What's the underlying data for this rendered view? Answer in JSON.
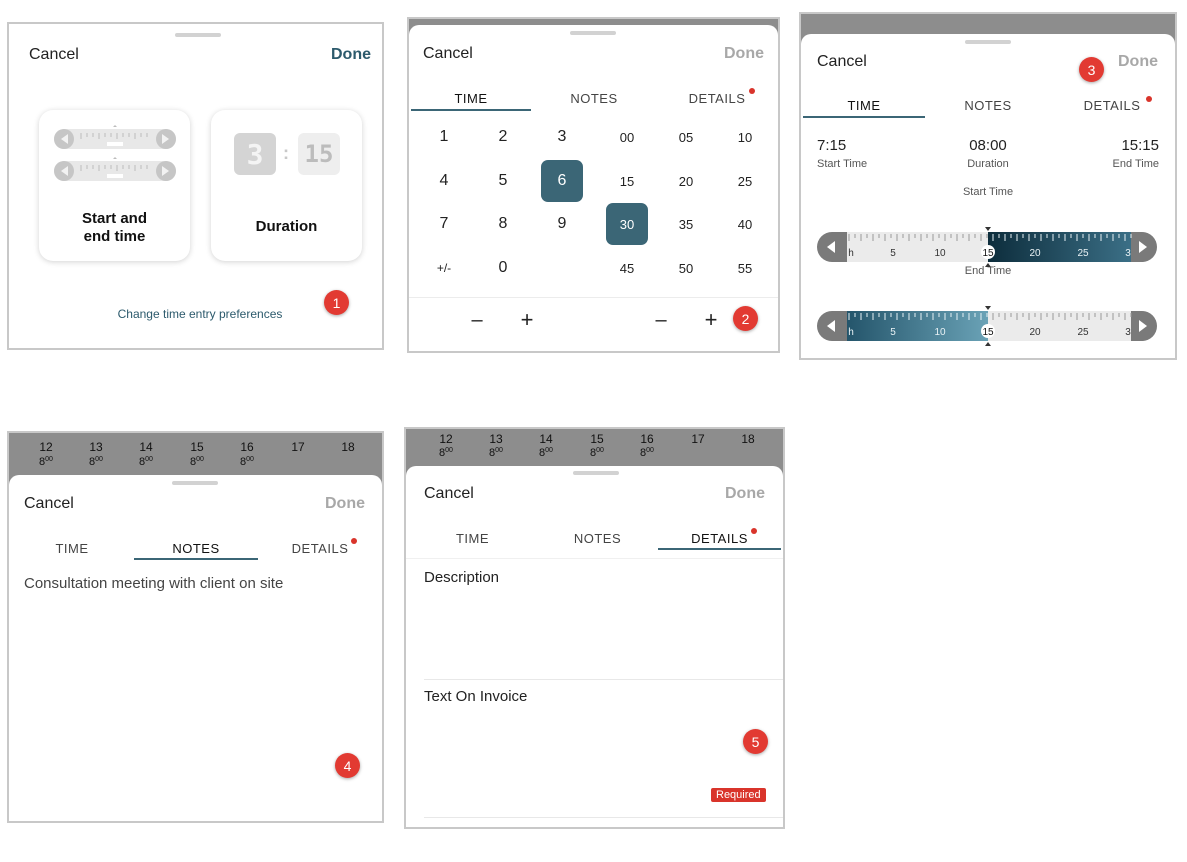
{
  "badges": [
    "1",
    "2",
    "3",
    "4",
    "5"
  ],
  "common": {
    "cancel": "Cancel",
    "done": "Done",
    "tabs": [
      "TIME",
      "NOTES",
      "DETAILS"
    ]
  },
  "panel1": {
    "option1": "Start and end time",
    "option1_line1": "Start and",
    "option1_line2": "end time",
    "option2": "Duration",
    "duration_hours": "3",
    "duration_colon": ":",
    "duration_minutes": "15",
    "link": "Change time entry preferences"
  },
  "panel2": {
    "hour_keys": [
      "1",
      "2",
      "3",
      "4",
      "5",
      "6",
      "7",
      "8",
      "9",
      "+/-",
      "0"
    ],
    "minute_keys": [
      "00",
      "05",
      "10",
      "15",
      "20",
      "25",
      "30",
      "35",
      "40",
      "45",
      "50",
      "55"
    ],
    "selected_hour": "6",
    "selected_minute": "30",
    "minus": "–",
    "plus": "+"
  },
  "panel3": {
    "start_value": "7:15",
    "start_label": "Start Time",
    "duration_value": "08:00",
    "duration_label": "Duration",
    "end_value": "15:15",
    "end_label": "End Time",
    "ruler1_title": "Start Time",
    "ruler2_title": "End Time",
    "ruler1_ticks": [
      "h",
      "5",
      "10",
      "15",
      "20",
      "25",
      "3"
    ],
    "ruler2_ticks": [
      "h",
      "5",
      "10",
      "15",
      "20",
      "25",
      "3"
    ]
  },
  "calendar": {
    "days": [
      "12",
      "13",
      "14",
      "15",
      "16",
      "17",
      "18"
    ],
    "hours": [
      "8",
      "8",
      "8",
      "8",
      "8"
    ],
    "hours_suffix": "00"
  },
  "panel4": {
    "notes_text": "Consultation meeting with client on site"
  },
  "panel5": {
    "description_label": "Description",
    "invoice_label": "Text On Invoice",
    "required": "Required"
  },
  "colors": {
    "accent": "#3b6676",
    "badge": "#e23a32",
    "done_active": "#2c5a6c",
    "done_disabled": "#a8a8a8"
  }
}
